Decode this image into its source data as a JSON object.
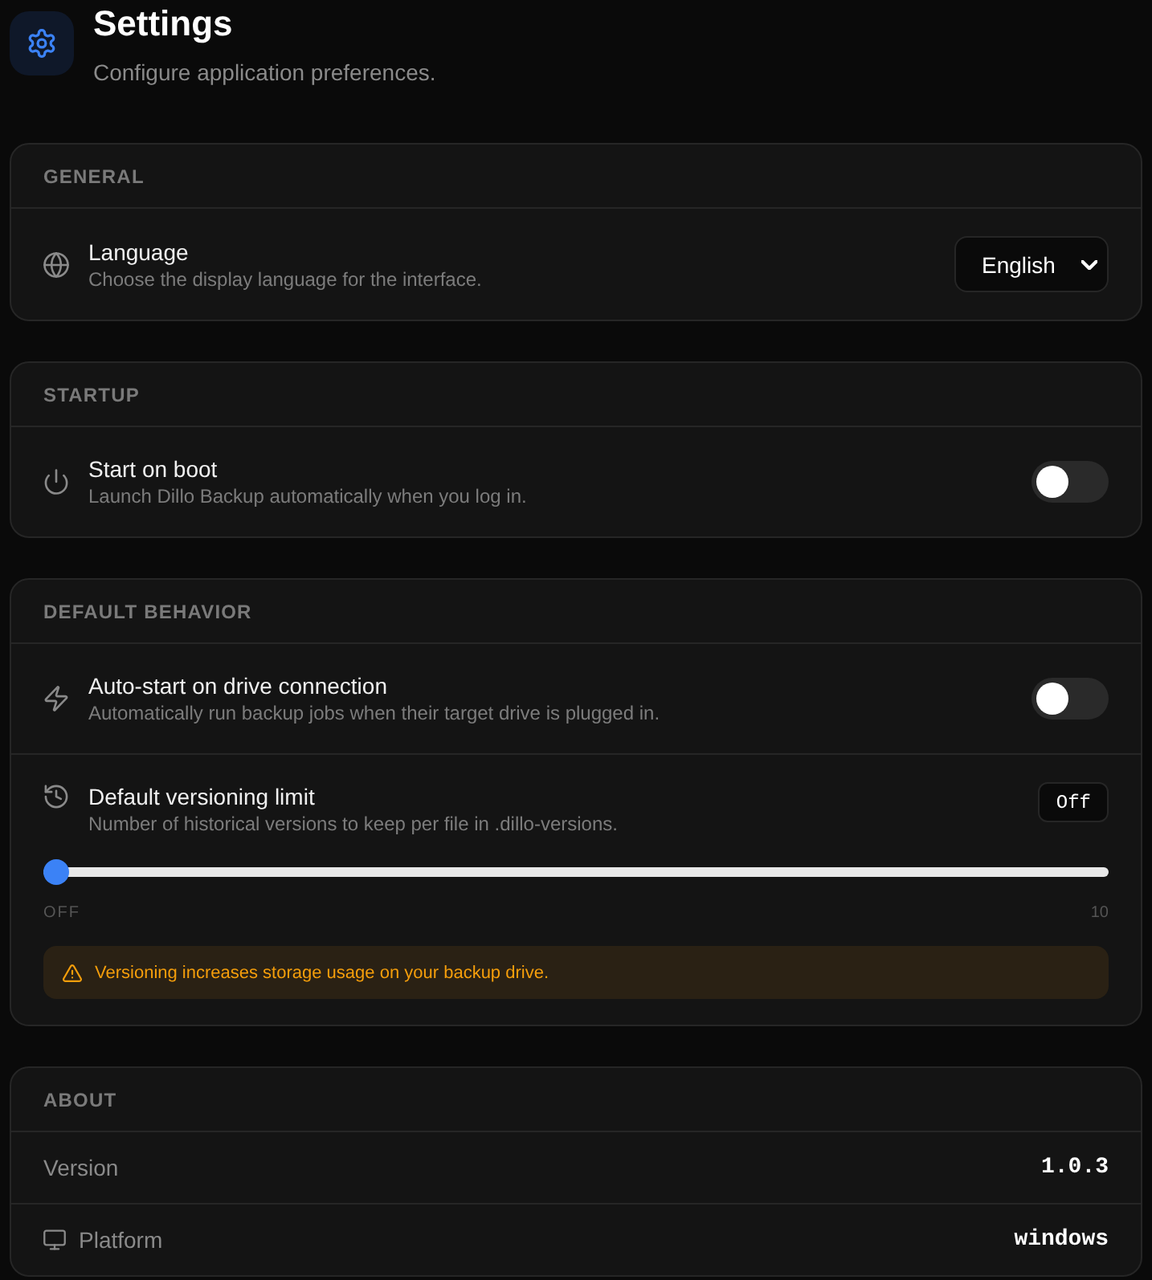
{
  "header": {
    "title": "Settings",
    "subtitle": "Configure application preferences."
  },
  "sections": [
    {
      "title": "GENERAL",
      "rows": [
        {
          "kind": "select",
          "title": "Language",
          "description": "Choose the display language for the interface.",
          "value": "English"
        }
      ]
    },
    {
      "title": "STARTUP",
      "rows": [
        {
          "kind": "toggle",
          "title": "Start on boot",
          "description": "Launch Dillo Backup automatically when you log in.",
          "on": false
        }
      ]
    },
    {
      "title": "DEFAULT BEHAVIOR",
      "rows": [
        {
          "kind": "toggle",
          "title": "Auto-start on drive connection",
          "description": "Automatically run backup jobs when their target drive is plugged in.",
          "on": false
        },
        {
          "kind": "slider",
          "title": "Default versioning limit",
          "description": "Number of historical versions to keep per file in .dillo-versions.",
          "value": "Off",
          "level": 0,
          "min_label": "OFF",
          "max_label": "10",
          "warning": "Versioning increases storage usage on your backup drive."
        }
      ]
    },
    {
      "title": "ABOUT",
      "rows": [
        {
          "kind": "info",
          "label": "Version",
          "value": "1.0.3"
        },
        {
          "kind": "info",
          "label": "Platform",
          "value": "windows"
        }
      ]
    }
  ]
}
